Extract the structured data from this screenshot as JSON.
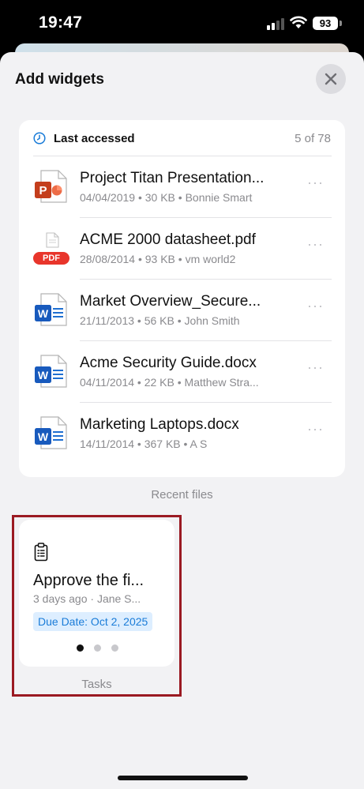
{
  "status_bar": {
    "time": "19:47",
    "battery": "93"
  },
  "sheet": {
    "title": "Add widgets",
    "close_icon": "close-icon"
  },
  "recent_files_widget": {
    "header_title": "Last accessed",
    "header_icon": "clock-icon",
    "count": "5 of 78",
    "caption": "Recent files",
    "files": [
      {
        "name": "Project Titan Presentation...",
        "meta": "04/04/2019 • 30 KB • Bonnie Smart",
        "type": "powerpoint"
      },
      {
        "name": "ACME 2000 datasheet.pdf",
        "meta": "28/08/2014 • 93 KB • vm world2",
        "type": "pdf",
        "badge": "PDF"
      },
      {
        "name": "Market Overview_Secure...",
        "meta": "21/11/2013 • 56 KB • John Smith",
        "type": "word"
      },
      {
        "name": "Acme Security Guide.docx",
        "meta": "04/11/2014 • 22 KB • Matthew Stra...",
        "type": "word"
      },
      {
        "name": "Marketing Laptops.docx",
        "meta": "14/11/2014 • 367 KB • A S",
        "type": "word"
      }
    ]
  },
  "tasks_widget": {
    "icon": "clipboard-icon",
    "title": "Approve the fi...",
    "meta": "3 days ago · Jane S...",
    "due": "Due Date: Oct 2, 2025",
    "caption": "Tasks",
    "page_indicator": {
      "pages": 3,
      "current": 1
    }
  },
  "colors": {
    "powerpoint": "#c43e1c",
    "word": "#185abd",
    "pdf_badge": "#e8352b",
    "accent_blue": "#1a7cd8",
    "highlight_outline": "#9b1a22"
  }
}
